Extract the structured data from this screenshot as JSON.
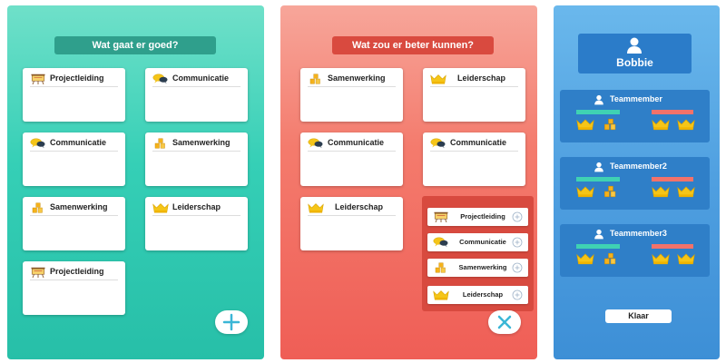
{
  "good": {
    "title": "Wat gaat er goed?",
    "cards": [
      {
        "label": "Projectleiding",
        "icon": "easel-icon"
      },
      {
        "label": "Communicatie",
        "icon": "speech-bubbles-icon"
      },
      {
        "label": "Communicatie",
        "icon": "speech-bubbles-icon"
      },
      {
        "label": "Samenwerking",
        "icon": "blocks-icon"
      },
      {
        "label": "Samenwerking",
        "icon": "blocks-icon"
      },
      {
        "label": "Leiderschap",
        "icon": "crown-icon"
      },
      {
        "label": "Projectleiding",
        "icon": "easel-icon"
      }
    ],
    "add_button_icon": "plus-icon"
  },
  "better": {
    "title": "Wat zou er beter kunnen?",
    "cards": [
      {
        "label": "Samenwerking",
        "icon": "blocks-icon"
      },
      {
        "label": "Leiderschap",
        "icon": "crown-icon"
      },
      {
        "label": "Communicatie",
        "icon": "speech-bubbles-icon"
      },
      {
        "label": "Communicatie",
        "icon": "speech-bubbles-icon"
      },
      {
        "label": "Leiderschap",
        "icon": "crown-icon"
      }
    ],
    "options": [
      {
        "label": "Projectleiding",
        "icon": "easel-icon"
      },
      {
        "label": "Communicatie",
        "icon": "speech-bubbles-icon"
      },
      {
        "label": "Samenwerking",
        "icon": "blocks-icon"
      },
      {
        "label": "Leiderschap",
        "icon": "crown-icon"
      }
    ],
    "close_button_icon": "close-icon"
  },
  "team": {
    "user_name": "Bobbie",
    "members": [
      {
        "name": "Teammember",
        "good_slots": [
          "crown-icon",
          "blocks-icon"
        ],
        "better_slots": [
          "crown-icon",
          "crown-icon"
        ]
      },
      {
        "name": "Teammember2",
        "good_slots": [
          "crown-icon",
          "blocks-icon"
        ],
        "better_slots": [
          "crown-icon",
          "crown-icon"
        ]
      },
      {
        "name": "Teammember3",
        "good_slots": [
          "crown-icon",
          "blocks-icon"
        ],
        "better_slots": [
          "crown-icon",
          "crown-icon"
        ]
      }
    ],
    "done_label": "Klaar"
  },
  "colors": {
    "good_accent": "#2f9f8c",
    "better_accent": "#d94a3f",
    "team_accent": "#2b7cc9",
    "good_bar": "#3fd2b3",
    "better_bar": "#f2726a"
  }
}
